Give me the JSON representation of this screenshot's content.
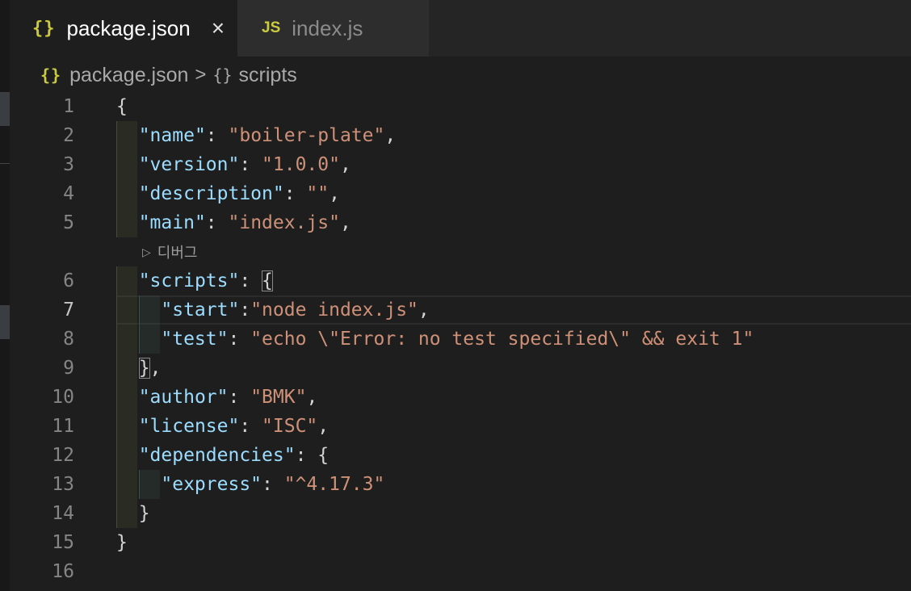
{
  "tabs": [
    {
      "icon": "{}",
      "label": "package.json",
      "active": true
    },
    {
      "icon": "JS",
      "label": "index.js",
      "active": false
    }
  ],
  "close_icon": "×",
  "breadcrumb": {
    "file_icon": "{}",
    "file": "package.json",
    "separator": ">",
    "object_icon": "{}",
    "symbol": "scripts"
  },
  "codelens": {
    "icon": "▷",
    "label": "디버그"
  },
  "line_numbers": [
    "1",
    "2",
    "3",
    "4",
    "5",
    "6",
    "7",
    "8",
    "9",
    "10",
    "11",
    "12",
    "13",
    "14",
    "15",
    "16"
  ],
  "current_line": "7",
  "code": {
    "open_brace": "{",
    "name_key": "\"name\"",
    "name_value": "\"boiler-plate\"",
    "version_key": "\"version\"",
    "version_value": "\"1.0.0\"",
    "description_key": "\"description\"",
    "description_value": "\"\"",
    "main_key": "\"main\"",
    "main_value": "\"index.js\"",
    "scripts_key": "\"scripts\"",
    "scripts_open": "{",
    "start_key": "\"start\"",
    "start_value": "\"node index.js\"",
    "test_key": "\"test\"",
    "test_value": "\"echo \\\"Error: no test specified\\\" && exit 1\"",
    "scripts_close": "}",
    "author_key": "\"author\"",
    "author_value": "\"BMK\"",
    "license_key": "\"license\"",
    "license_value": "\"ISC\"",
    "dependencies_key": "\"dependencies\"",
    "dependencies_open": "{",
    "express_key": "\"express\"",
    "express_value": "\"^4.17.3\"",
    "dependencies_close": "}",
    "close_brace": "}"
  }
}
